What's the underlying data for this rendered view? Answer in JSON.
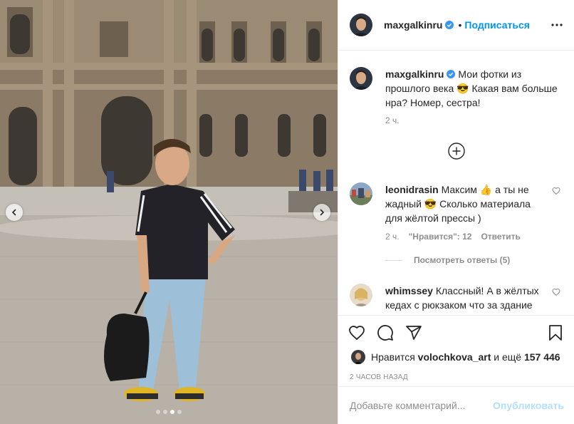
{
  "post": {
    "author": "maxgalkinru",
    "follow_label": "Подписаться",
    "separator": "•",
    "caption": "Мои фотки из прошлого века 😎 Какая вам больше нра? Номер, сестра!",
    "caption_time": "2 ч."
  },
  "comments": [
    {
      "username": "leonidrasin",
      "text": "Максим 👍 а ты не жадный 😎 Сколько материала для жёлтой прессы )",
      "time": "2 ч.",
      "likes_label": "\"Нравится\": 12",
      "reply_label": "Ответить",
      "view_replies": "Посмотреть ответы (5)"
    },
    {
      "username": "whimssey",
      "text": "Классный! А в жёлтых кедах с рюкзаком что за здание"
    }
  ],
  "likes": {
    "prefix": "Нравится",
    "user": "volochkova_art",
    "connector": "и ещё",
    "count": "157 446"
  },
  "post_time": "2 ЧАСОВ НАЗАД",
  "add_comment": {
    "placeholder": "Добавьте комментарий...",
    "publish_label": "Опубликовать"
  },
  "carousel": {
    "total": 4,
    "active_index": 2
  },
  "colors": {
    "accent": "#0095f6",
    "publish_disabled": "#b2dffc",
    "verified": "#3897f0"
  },
  "icons": [
    "verified-badge-icon",
    "more-options-icon",
    "add-circle-icon",
    "heart-icon",
    "comment-icon",
    "share-icon",
    "bookmark-icon",
    "chevron-left-icon",
    "chevron-right-icon"
  ]
}
